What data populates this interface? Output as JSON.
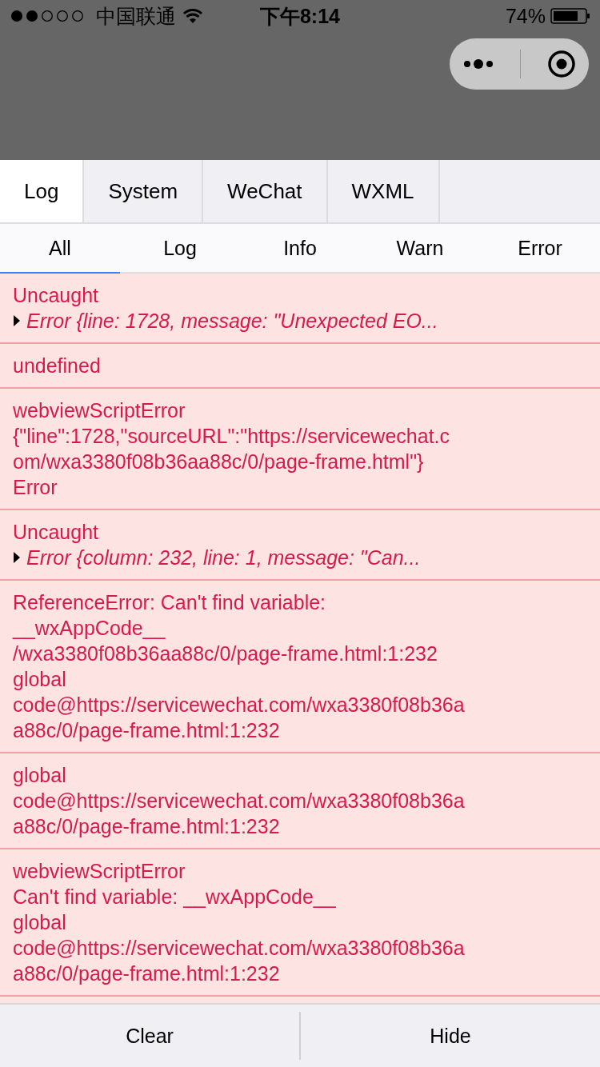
{
  "status_bar": {
    "carrier": "中国联通",
    "time": "下午8:14",
    "battery": "74%"
  },
  "tabs": [
    {
      "label": "Log",
      "selected": true
    },
    {
      "label": "System",
      "selected": false
    },
    {
      "label": "WeChat",
      "selected": false
    },
    {
      "label": "WXML",
      "selected": false
    }
  ],
  "filters": [
    {
      "label": "All",
      "selected": true
    },
    {
      "label": "Log",
      "selected": false
    },
    {
      "label": "Info",
      "selected": false
    },
    {
      "label": "Warn",
      "selected": false
    },
    {
      "label": "Error",
      "selected": false
    }
  ],
  "entries": [
    {
      "lines": [
        {
          "kind": "plain",
          "text": "Uncaught"
        },
        {
          "kind": "object",
          "text": "Error {line: 1728, message: \"Unexpected EO..."
        }
      ]
    },
    {
      "lines": [
        {
          "kind": "plain",
          "text": "undefined"
        }
      ]
    },
    {
      "lines": [
        {
          "kind": "plain",
          "text": "webviewScriptError"
        },
        {
          "kind": "plain",
          "text": "{\"line\":1728,\"sourceURL\":\"https://servicewechat.c"
        },
        {
          "kind": "plain",
          "text": "om/wxa3380f08b36aa88c/0/page-frame.html\"}"
        },
        {
          "kind": "plain",
          "text": "Error"
        }
      ]
    },
    {
      "lines": [
        {
          "kind": "plain",
          "text": "Uncaught"
        },
        {
          "kind": "object",
          "text": "Error {column: 232, line: 1, message: \"Can..."
        }
      ]
    },
    {
      "lines": [
        {
          "kind": "plain",
          "text": "ReferenceError: Can't find variable:"
        },
        {
          "kind": "plain",
          "text": "__wxAppCode__"
        },
        {
          "kind": "plain",
          "text": "/wxa3380f08b36aa88c/0/page-frame.html:1:232"
        },
        {
          "kind": "plain",
          "text": "global"
        },
        {
          "kind": "plain",
          "text": "code@https://servicewechat.com/wxa3380f08b36a"
        },
        {
          "kind": "plain",
          "text": "a88c/0/page-frame.html:1:232"
        }
      ]
    },
    {
      "lines": [
        {
          "kind": "plain",
          "text": "global"
        },
        {
          "kind": "plain",
          "text": "code@https://servicewechat.com/wxa3380f08b36a"
        },
        {
          "kind": "plain",
          "text": "a88c/0/page-frame.html:1:232"
        }
      ]
    },
    {
      "lines": [
        {
          "kind": "plain",
          "text": "webviewScriptError"
        },
        {
          "kind": "plain",
          "text": "Can't find variable: __wxAppCode__"
        },
        {
          "kind": "plain",
          "text": "global"
        },
        {
          "kind": "plain",
          "text": "code@https://servicewechat.com/wxa3380f08b36a"
        },
        {
          "kind": "plain",
          "text": "a88c/0/page-frame.html:1:232"
        }
      ]
    }
  ],
  "buttons": [
    "Clear",
    "Hide"
  ]
}
